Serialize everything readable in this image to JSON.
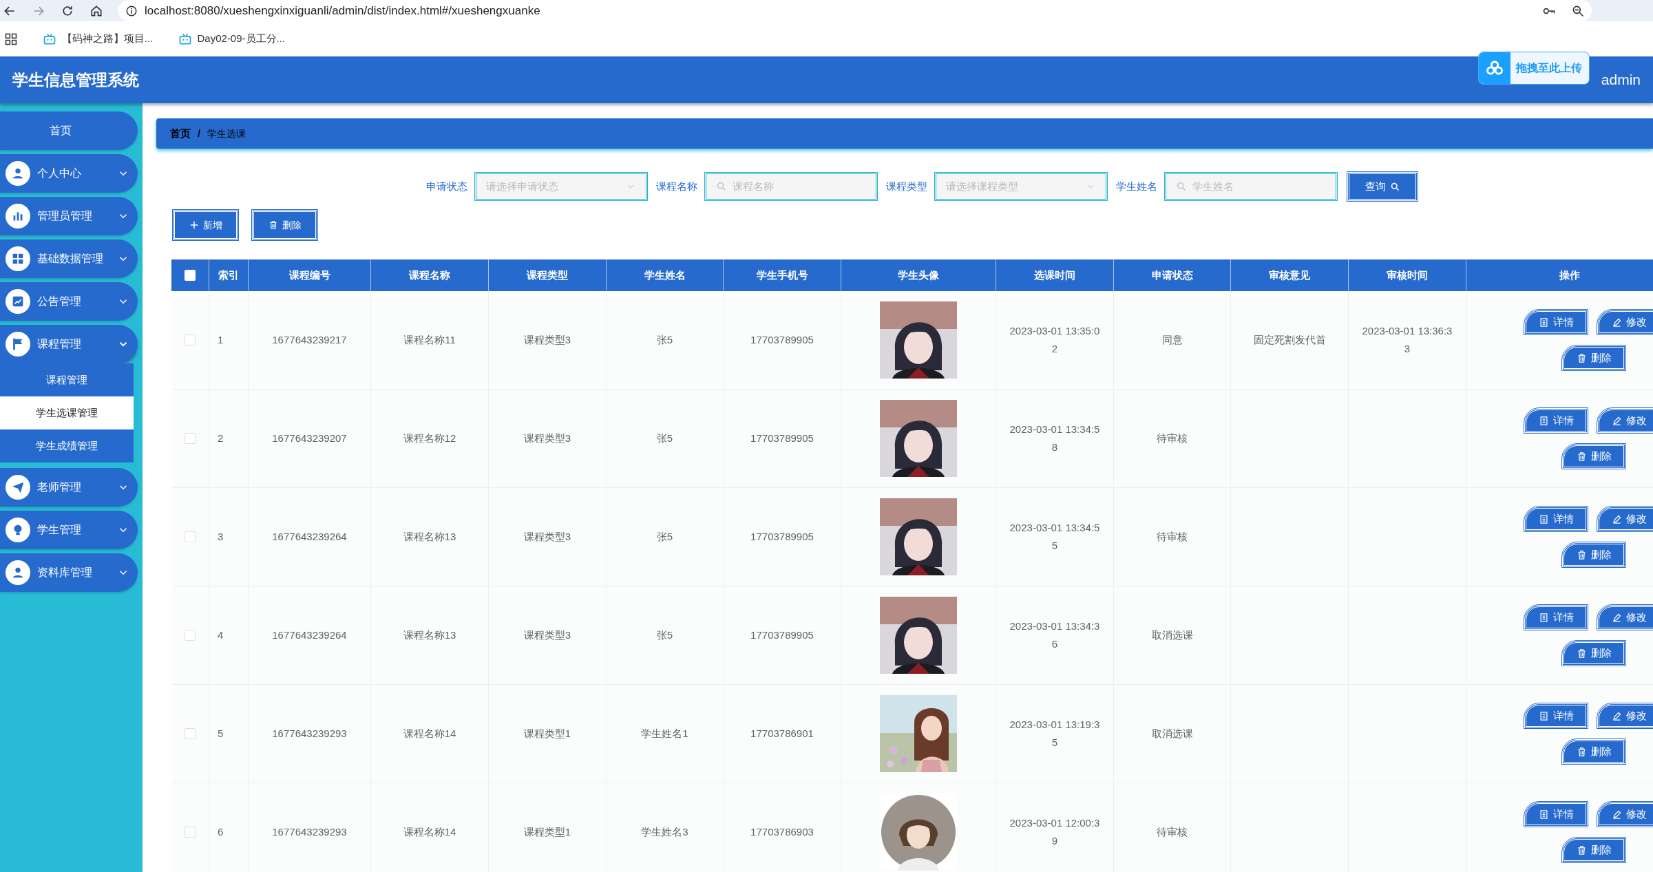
{
  "browser": {
    "url": "localhost:8080/xueshengxinxiguanli/admin/dist/index.html#/xueshengxuanke",
    "bookmarks": [
      "【码神之路】项目...",
      "Day02-09-员工分..."
    ]
  },
  "header": {
    "title": "学生信息管理系统",
    "user": "admin",
    "upload_overlay": "拖拽至此上传"
  },
  "sidebar": {
    "items": [
      {
        "label": "首页"
      },
      {
        "label": "个人中心",
        "expanded": false
      },
      {
        "label": "管理员管理",
        "expanded": false
      },
      {
        "label": "基础数据管理",
        "expanded": false
      },
      {
        "label": "公告管理",
        "expanded": false
      },
      {
        "label": "课程管理",
        "expanded": true,
        "children": [
          {
            "label": "课程管理",
            "selected": false
          },
          {
            "label": "学生选课管理",
            "selected": true
          },
          {
            "label": "学生成绩管理",
            "selected": false
          }
        ]
      },
      {
        "label": "老师管理",
        "expanded": false
      },
      {
        "label": "学生管理",
        "expanded": false
      },
      {
        "label": "资料库管理",
        "expanded": false
      }
    ]
  },
  "breadcrumb": [
    "首页",
    "学生选课"
  ],
  "breadcrumb_separator": "/",
  "filters": [
    {
      "label": "申请状态",
      "kind": "select",
      "placeholder": "请选择申请状态"
    },
    {
      "label": "课程名称",
      "kind": "search",
      "placeholder": "课程名称"
    },
    {
      "label": "课程类型",
      "kind": "select",
      "placeholder": "请选择课程类型"
    },
    {
      "label": "学生姓名",
      "kind": "search",
      "placeholder": "学生姓名"
    }
  ],
  "query_button": "查询",
  "toolbar": [
    {
      "label": "新增",
      "kind": "add"
    },
    {
      "label": "删除",
      "kind": "delete"
    }
  ],
  "table": {
    "select_all_checked": false,
    "columns": [
      "索引",
      "课程编号",
      "课程名称",
      "课程类型",
      "学生姓名",
      "学生手机号",
      "学生头像",
      "选课时间",
      "申请状态",
      "审核意见",
      "审核时间",
      "操作"
    ],
    "rows": [
      {
        "checked": false,
        "index": "1",
        "course_no": "1677643239217",
        "course_name": "课程名称11",
        "course_type": "课程类型3",
        "student": "张5",
        "phone": "17703789905",
        "time": "2023-03-01 13:35:02",
        "status": "同意",
        "opinion": "固定死割发代首",
        "review_time": "2023-03-01 13:36:33",
        "actions": [
          "详情",
          "修改",
          "删除"
        ]
      },
      {
        "checked": false,
        "index": "2",
        "course_no": "1677643239207",
        "course_name": "课程名称12",
        "course_type": "课程类型3",
        "student": "张5",
        "phone": "17703789905",
        "time": "2023-03-01 13:34:58",
        "status": "待审核",
        "actions": [
          "详情",
          "修改",
          "删除"
        ]
      },
      {
        "checked": false,
        "index": "3",
        "course_no": "1677643239264",
        "course_name": "课程名称13",
        "course_type": "课程类型3",
        "student": "张5",
        "phone": "17703789905",
        "time": "2023-03-01 13:34:55",
        "status": "待审核",
        "actions": [
          "详情",
          "修改",
          "删除"
        ]
      },
      {
        "checked": false,
        "index": "4",
        "course_no": "1677643239264",
        "course_name": "课程名称13",
        "course_type": "课程类型3",
        "student": "张5",
        "phone": "17703789905",
        "time": "2023-03-01 13:34:36",
        "status": "取消选课",
        "actions": [
          "详情",
          "修改",
          "删除"
        ]
      },
      {
        "checked": false,
        "index": "5",
        "course_no": "1677643239293",
        "course_name": "课程名称14",
        "course_type": "课程类型1",
        "student": "学生姓名1",
        "phone": "17703786901",
        "time": "2023-03-01 13:19:35",
        "status": "取消选课",
        "actions": [
          "详情",
          "修改",
          "删除"
        ]
      },
      {
        "checked": false,
        "index": "6",
        "course_no": "1677643239293",
        "course_name": "课程名称14",
        "course_type": "课程类型1",
        "student": "学生姓名3",
        "phone": "17703786903",
        "time": "2023-03-01 12:00:39",
        "status": "待审核",
        "actions": [
          "详情",
          "修改",
          "删除"
        ]
      }
    ]
  }
}
